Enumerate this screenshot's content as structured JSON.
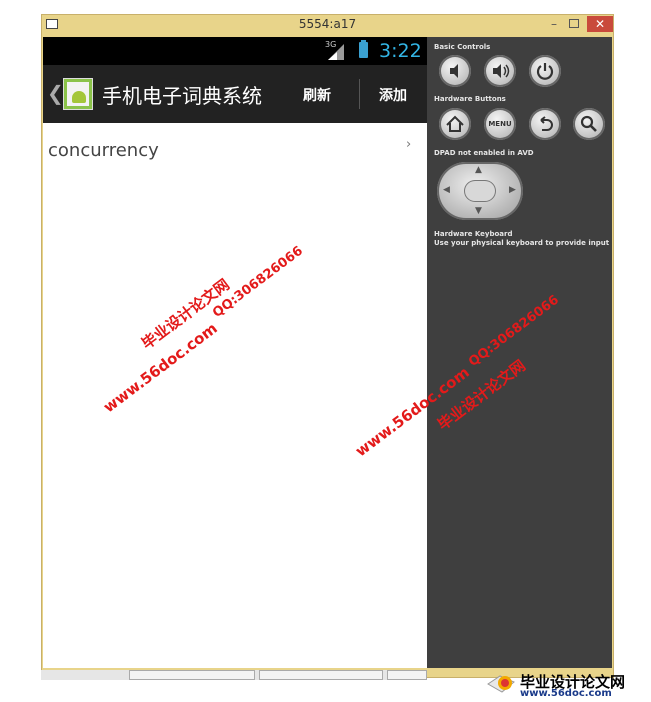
{
  "window": {
    "title": "5554:a17",
    "minimize_glyph": "–",
    "close_glyph": "✕"
  },
  "status_bar": {
    "network": "3G",
    "time": "3:22"
  },
  "action_bar": {
    "back_glyph": "❮",
    "title": "手机电子词典系统",
    "refresh_label": "刷新",
    "add_label": "添加"
  },
  "list": {
    "items": [
      {
        "label": "concurrency",
        "chevron": "›"
      }
    ]
  },
  "panel": {
    "basic_controls_label": "Basic Controls",
    "hardware_buttons_label": "Hardware Buttons",
    "menu_label": "MENU",
    "dpad_label": "DPAD not enabled in AVD",
    "keyboard_label": "Hardware Keyboard",
    "keyboard_hint": "Use your physical keyboard to provide input",
    "icons": [
      "volume-down-icon",
      "volume-up-icon",
      "power-icon",
      "home-icon",
      "menu-icon",
      "back-icon",
      "search-icon"
    ]
  },
  "watermarks": {
    "cn": "毕业设计论文网",
    "url": "www.56doc.com",
    "qq": "QQ:306826066"
  },
  "corner_watermark": {
    "cn": "毕业设计论文网",
    "url": "www.56doc.com"
  },
  "colors": {
    "accent": "#33b5e5",
    "action_bar": "#222222",
    "panel": "#3f3f3f",
    "watermark": "#e31a1a"
  }
}
